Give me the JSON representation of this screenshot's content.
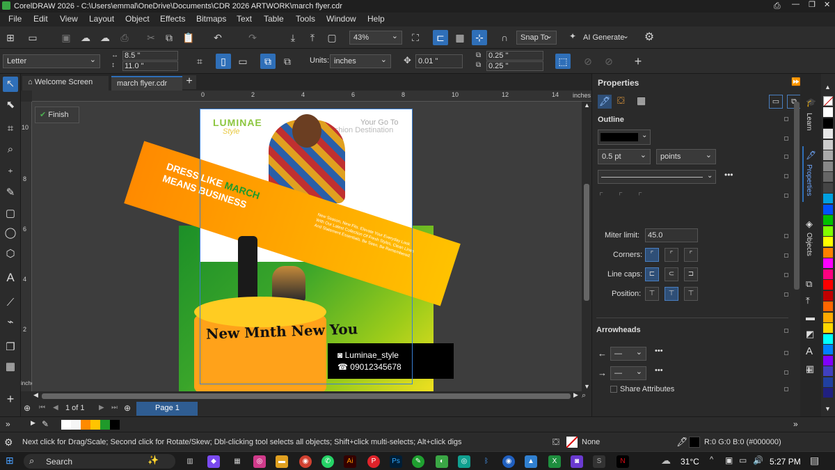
{
  "title": "CorelDRAW 2026 - C:\\Users\\emmal\\OneDrive\\Documents\\CDR 2026 ARTWORK\\march flyer.cdr",
  "menu": [
    "File",
    "Edit",
    "View",
    "Layout",
    "Object",
    "Effects",
    "Bitmaps",
    "Text",
    "Table",
    "Tools",
    "Window",
    "Help"
  ],
  "toolbar": {
    "zoom": "43%",
    "snap_to": "Snap To",
    "ai_generate": "AI Generate"
  },
  "propbar": {
    "page_size": "Letter",
    "width": "8.5 \"",
    "height": "11.0 \"",
    "units_label": "Units:",
    "units": "inches",
    "nudge": "0.01 \"",
    "dup_x": "0.25 \"",
    "dup_y": "0.25 \""
  },
  "tabs": {
    "welcome": "Welcome Screen",
    "doc": "march flyer.cdr"
  },
  "ruler": {
    "h_ticks": [
      "0",
      "2",
      "4",
      "6",
      "8",
      "10",
      "12",
      "14"
    ],
    "units": "inches",
    "v_ticks": [
      "10",
      "8",
      "6",
      "4",
      "2"
    ],
    "v_units": "inches"
  },
  "finish_button": "Finish",
  "flyer": {
    "brand": "LUMINAE",
    "brand_script": "Style",
    "tagline1": "Your Go To",
    "tagline2": "Fashion Destination",
    "headline1a": "DRESS LIKE ",
    "headline1b": "MARCH",
    "headline2": "MEANS BUSINESS",
    "body": "New Season, New Fits. Elevate Your Everyday Look With Our Latest Collection Of Fresh Styles, Clean Lines And Statement Essentials. Be Seen. Be Remembered.",
    "slogan": "New Mnth New You",
    "social": "Luminae_style",
    "phone": "09012345678"
  },
  "pagebar": {
    "page_count": "1 of 1",
    "page_tab": "Page 1"
  },
  "panel": {
    "title": "Properties",
    "outline_title": "Outline",
    "width": "0.5 pt",
    "units": "points",
    "miter_label": "Miter limit:",
    "miter": "45.0",
    "corners_label": "Corners:",
    "linecaps_label": "Line caps:",
    "position_label": "Position:",
    "arrowheads_title": "Arrowheads",
    "share_attrs": "Share Attributes"
  },
  "sidetabs": {
    "learn": "Learn",
    "properties": "Properties",
    "objects": "Objects"
  },
  "status": {
    "hint": "Next click for Drag/Scale; Second click for Rotate/Skew; Dbl-clicking tool selects all objects; Shift+click multi-selects; Alt+click digs",
    "fill": "None",
    "outline": "R:0 G:0 B:0 (#000000)"
  },
  "taskbar": {
    "search": "Search",
    "temp": "31°C",
    "time": "5:27 PM"
  },
  "colors": {
    "accent": "#2f6fb8",
    "orange": "#ff8a00",
    "green": "#1f9a2a",
    "yellow": "#ffc400"
  },
  "palette": [
    "#ffffff",
    "#000000",
    "#e8e8e8",
    "#cccccc",
    "#aaaaaa",
    "#888888",
    "#666666",
    "#444444",
    "#00a0e0",
    "#0050ff",
    "#00c000",
    "#80ff00",
    "#ffff00",
    "#ff8000",
    "#ff00ff",
    "#ff0080",
    "#ff0000",
    "#c00000",
    "#ff6600",
    "#ffaa00",
    "#ffd700",
    "#00ffff",
    "#0080ff",
    "#8000ff",
    "#4040c0",
    "#2040a0",
    "#202080"
  ]
}
